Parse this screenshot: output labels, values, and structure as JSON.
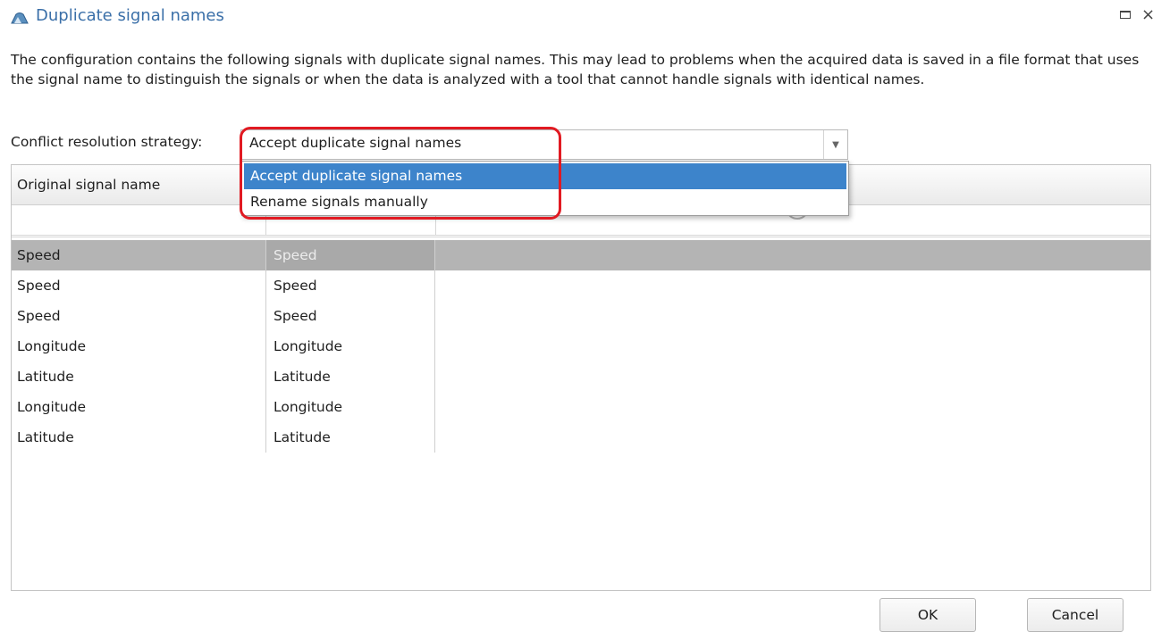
{
  "window": {
    "title": "Duplicate signal names",
    "maximize_glyph": "□",
    "close_glyph": "×"
  },
  "description": "The configuration contains the following signals with duplicate signal names. This may lead to problems when the acquired data is saved in a file format that uses the signal name to distinguish the signals or when the data is analyzed with a tool that cannot handle signals with identical names.",
  "strategy": {
    "label": "Conflict resolution strategy:",
    "value": "Accept duplicate signal names",
    "options": [
      "Accept duplicate signal names",
      "Rename signals manually"
    ]
  },
  "grid": {
    "columns": [
      "Original signal name"
    ],
    "rows": [
      {
        "original": "Speed",
        "new_name": "Speed",
        "status_icon": "forbidden-icon"
      },
      {
        "original": "Speed",
        "new_name": "Speed",
        "status_icon": "forbidden-icon"
      },
      {
        "original": "Speed",
        "new_name": "Speed",
        "status_icon": "forbidden-icon"
      },
      {
        "original": "Longitude",
        "new_name": "Longitude",
        "status_icon": "forbidden-icon"
      },
      {
        "original": "Latitude",
        "new_name": "Latitude",
        "status_icon": "forbidden-icon"
      },
      {
        "original": "Longitude",
        "new_name": "Longitude",
        "status_icon": "forbidden-icon"
      },
      {
        "original": "Latitude",
        "new_name": "Latitude",
        "status_icon": "forbidden-icon"
      }
    ]
  },
  "buttons": {
    "ok": "OK",
    "cancel": "Cancel"
  },
  "colors": {
    "title": "#3a6fa8",
    "selection": "#3d84cb",
    "highlight": "#e11a22",
    "forbidden": "#d9414a"
  }
}
